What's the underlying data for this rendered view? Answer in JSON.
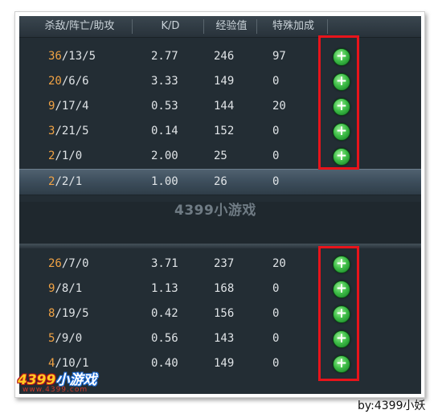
{
  "header": {
    "columns": [
      "杀敌/阵亡/助攻",
      "K/D",
      "经验值",
      "特殊加成"
    ]
  },
  "team_top": [
    {
      "kills": "36",
      "rest": "/13/5",
      "kd": "2.77",
      "exp": "246",
      "bonus": "97",
      "plus": true
    },
    {
      "kills": "20",
      "rest": "/6/6",
      "kd": "3.33",
      "exp": "149",
      "bonus": "0",
      "plus": true
    },
    {
      "kills": "9",
      "rest": "/17/4",
      "kd": "0.53",
      "exp": "144",
      "bonus": "20",
      "plus": true
    },
    {
      "kills": "3",
      "rest": "/21/5",
      "kd": "0.14",
      "exp": "152",
      "bonus": "0",
      "plus": true
    },
    {
      "kills": "2",
      "rest": "/1/0",
      "kd": "2.00",
      "exp": "25",
      "bonus": "0",
      "plus": true
    },
    {
      "kills": "2",
      "rest": "/2/1",
      "kd": "1.00",
      "exp": "26",
      "bonus": "0",
      "plus": false,
      "highlight": true
    }
  ],
  "team_bottom": [
    {
      "kills": "26",
      "rest": "/7/0",
      "kd": "3.71",
      "exp": "237",
      "bonus": "20",
      "plus": true
    },
    {
      "kills": "9",
      "rest": "/8/1",
      "kd": "1.13",
      "exp": "168",
      "bonus": "0",
      "plus": true
    },
    {
      "kills": "8",
      "rest": "/19/5",
      "kd": "0.42",
      "exp": "156",
      "bonus": "0",
      "plus": true
    },
    {
      "kills": "5",
      "rest": "/9/0",
      "kd": "0.56",
      "exp": "143",
      "bonus": "0",
      "plus": true
    },
    {
      "kills": "4",
      "rest": "/10/1",
      "kd": "0.40",
      "exp": "149",
      "bonus": "0",
      "plus": true
    }
  ],
  "plus_symbol": "+",
  "watermark": "4399小游戏",
  "logo": {
    "brand": "4399",
    "brand_cn": "小游戏",
    "url": "www.4399.com"
  },
  "credit": "by:4399小妖",
  "colors": {
    "kills": "#f0a244",
    "text": "#dfe3e6",
    "highlight_box": "#e8141b",
    "plus": "#3fbf48"
  },
  "icons": [
    "add-bonus-icon"
  ]
}
